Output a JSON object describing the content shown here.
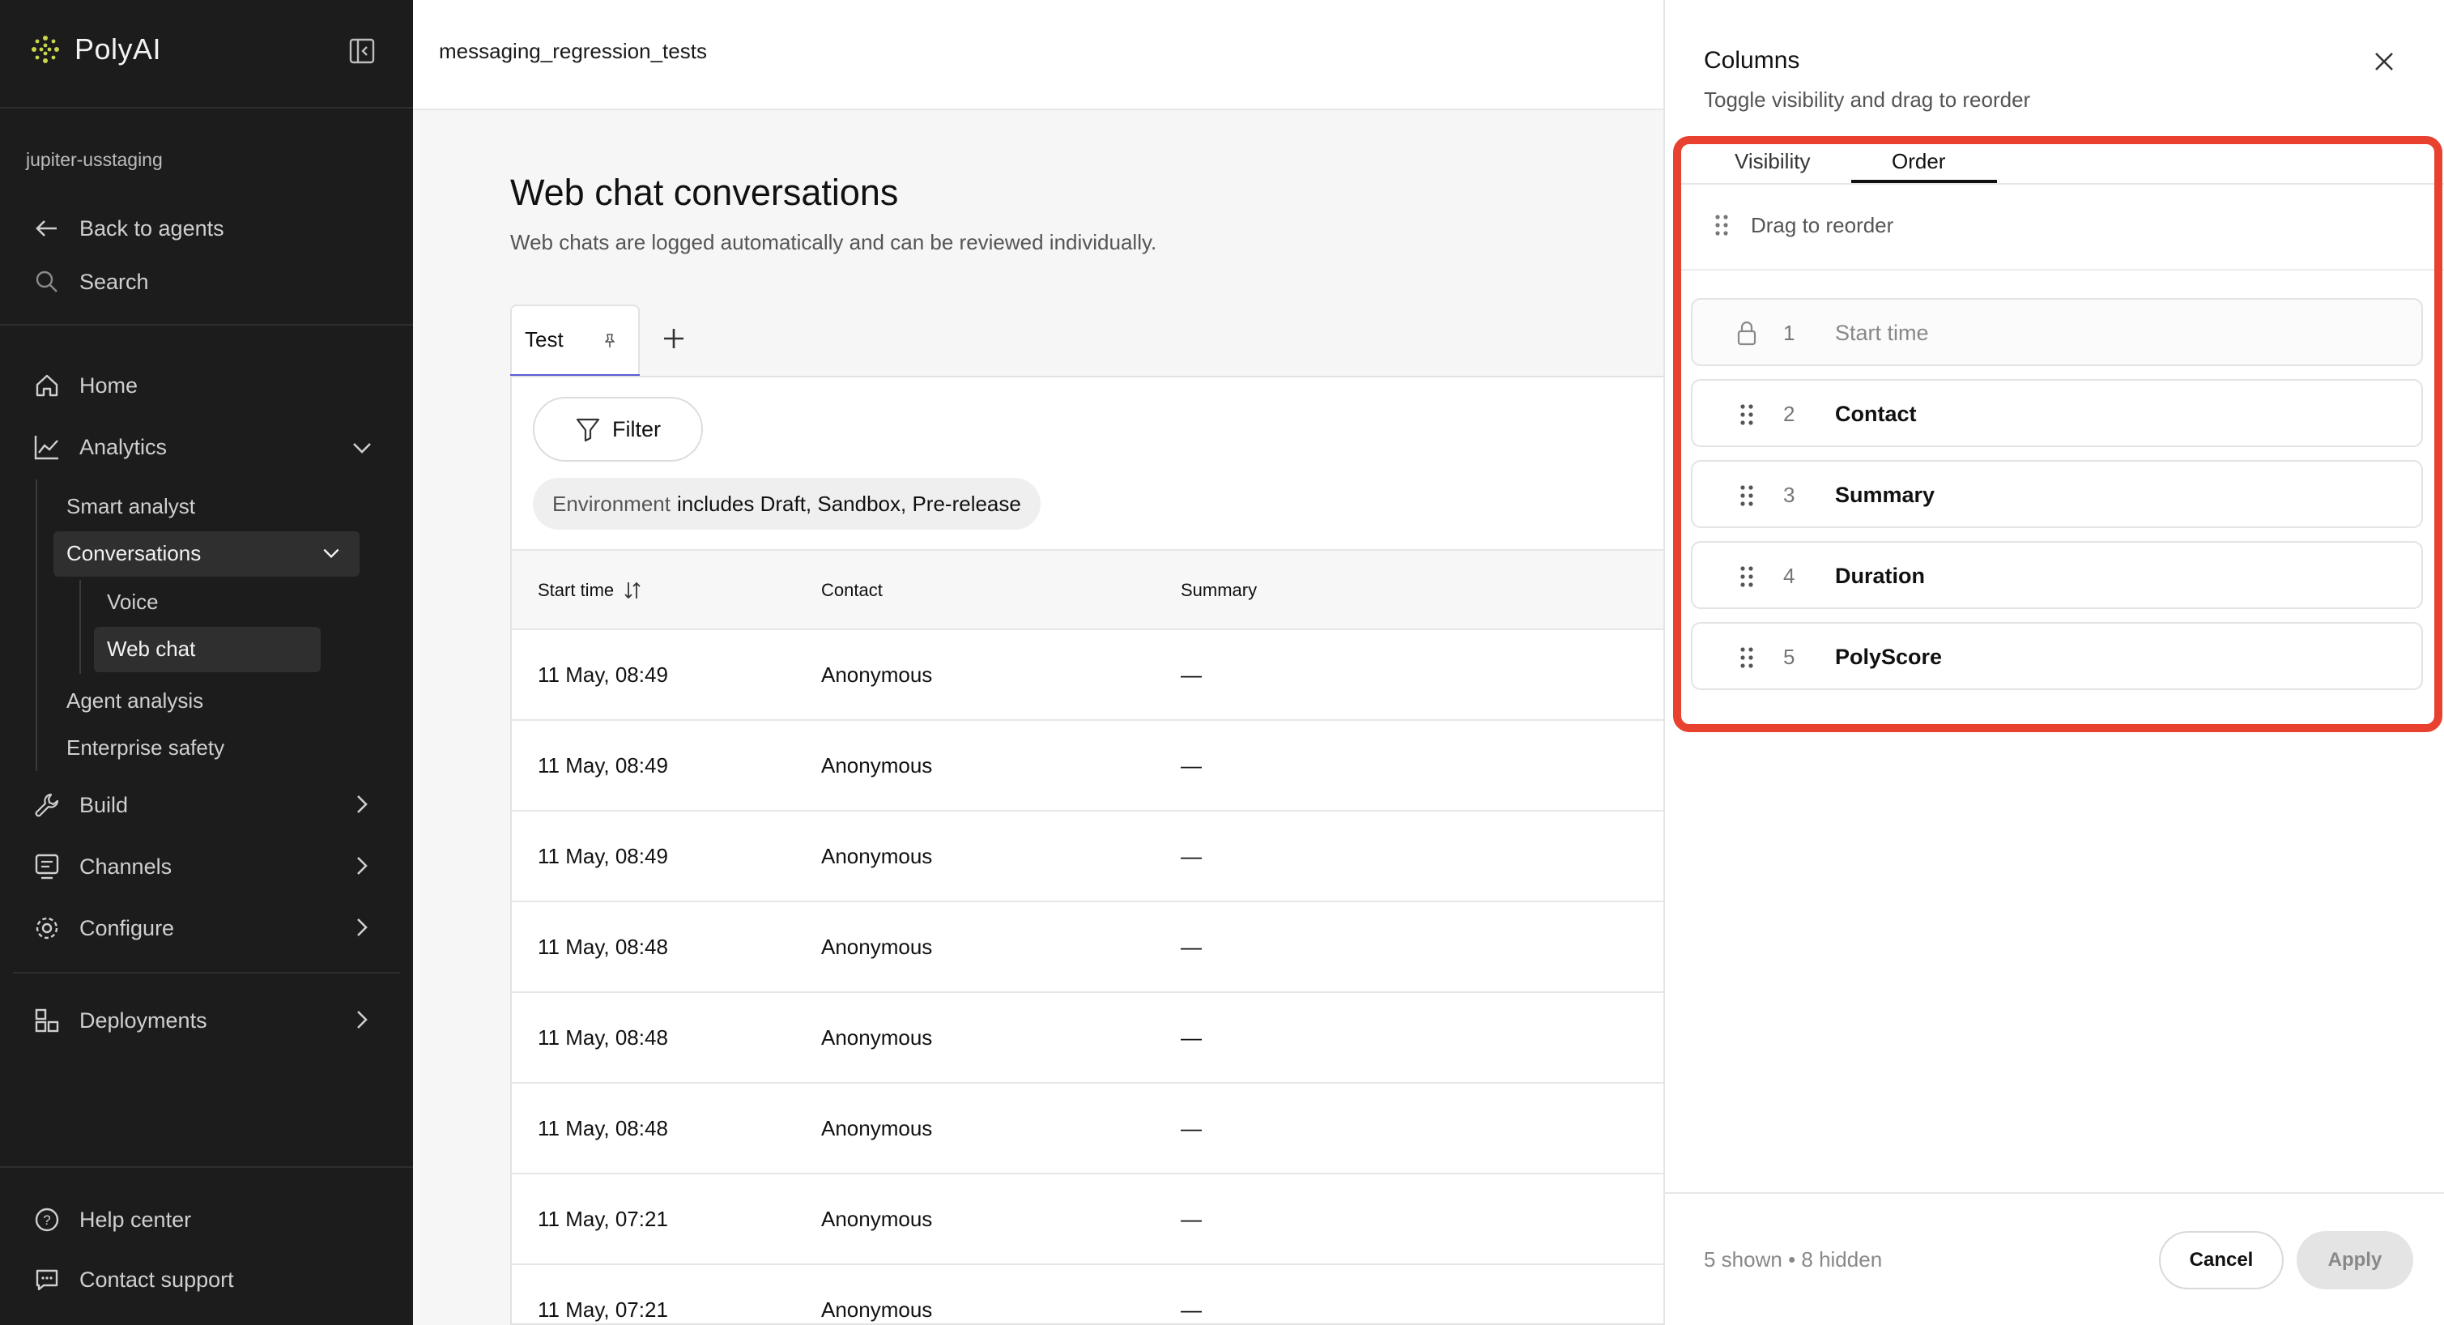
{
  "brand": {
    "name": "PolyAI"
  },
  "workspace": "jupiter-usstaging",
  "sidebar": {
    "back": "Back to agents",
    "search": "Search",
    "home": "Home",
    "analytics": "Analytics",
    "analytics_sub": {
      "smart_analyst": "Smart analyst",
      "conversations": "Conversations",
      "voice": "Voice",
      "web_chat": "Web chat",
      "agent_analysis": "Agent analysis",
      "enterprise_safety": "Enterprise safety"
    },
    "build": "Build",
    "channels": "Channels",
    "configure": "Configure",
    "deployments": "Deployments",
    "help": "Help center",
    "support": "Contact support"
  },
  "topbar": {
    "breadcrumb": "messaging_regression_tests"
  },
  "page": {
    "title": "Web chat conversations",
    "subtitle": "Web chats are logged automatically and can be reviewed individually.",
    "tab_label": "Test",
    "filter_label": "Filter",
    "env_prefix": "Environment",
    "env_value": "includes Draft, Sandbox, Pre-release"
  },
  "table": {
    "headers": {
      "start_time": "Start time",
      "contact": "Contact",
      "summary": "Summary"
    },
    "rows": [
      {
        "start": "11 May, 08:49",
        "contact": "Anonymous",
        "summary": "—"
      },
      {
        "start": "11 May, 08:49",
        "contact": "Anonymous",
        "summary": "—"
      },
      {
        "start": "11 May, 08:49",
        "contact": "Anonymous",
        "summary": "—"
      },
      {
        "start": "11 May, 08:48",
        "contact": "Anonymous",
        "summary": "—"
      },
      {
        "start": "11 May, 08:48",
        "contact": "Anonymous",
        "summary": "—"
      },
      {
        "start": "11 May, 08:48",
        "contact": "Anonymous",
        "summary": "—"
      },
      {
        "start": "11 May, 07:21",
        "contact": "Anonymous",
        "summary": "—"
      },
      {
        "start": "11 May, 07:21",
        "contact": "Anonymous",
        "summary": "—"
      }
    ]
  },
  "drawer": {
    "title": "Columns",
    "subtitle": "Toggle visibility and drag to reorder",
    "tab_visibility": "Visibility",
    "tab_order": "Order",
    "drag_hint": "Drag to reorder",
    "columns": [
      {
        "num": "1",
        "name": "Start time",
        "locked": true
      },
      {
        "num": "2",
        "name": "Contact",
        "locked": false
      },
      {
        "num": "3",
        "name": "Summary",
        "locked": false
      },
      {
        "num": "4",
        "name": "Duration",
        "locked": false
      },
      {
        "num": "5",
        "name": "PolyScore",
        "locked": false
      }
    ],
    "shown_text": "5 shown • 8 hidden",
    "cancel": "Cancel",
    "apply": "Apply"
  },
  "colors": {
    "highlight": "#e8412f",
    "tab_accent": "#5b5bd6",
    "sidebar_bg": "#1c1c1c",
    "brand_accent": "#c9d64b"
  }
}
